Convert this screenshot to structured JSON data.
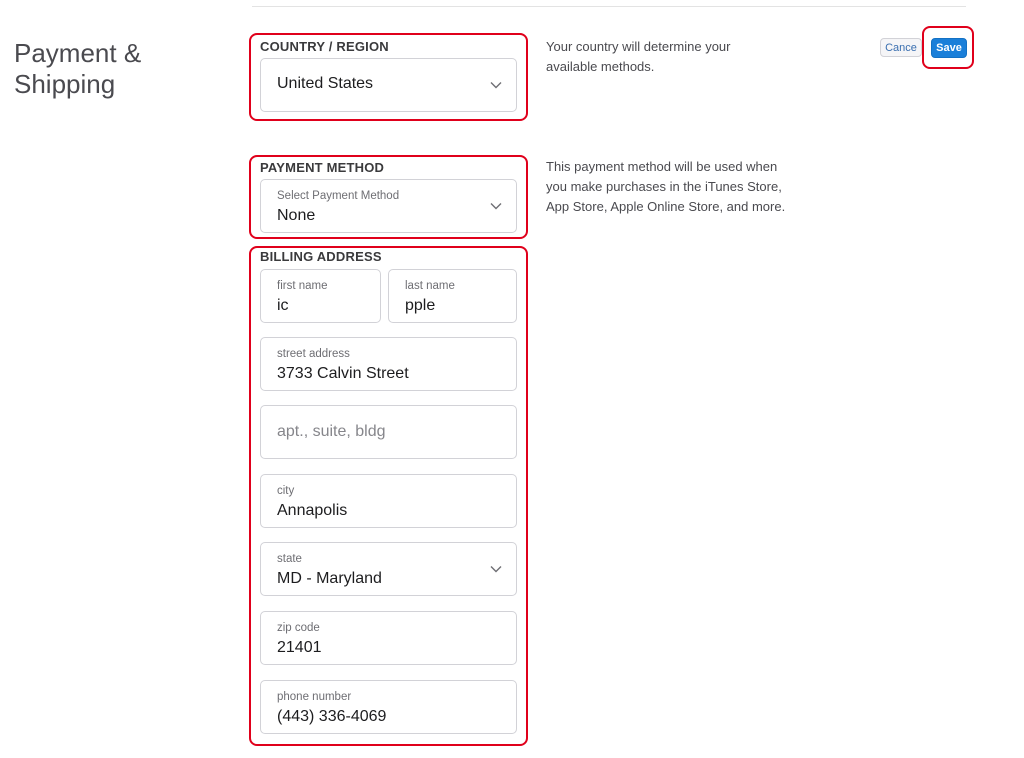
{
  "section": {
    "title_line1": "Payment &",
    "title_line2": "Shipping"
  },
  "toolbar": {
    "cancel_label": "Cance",
    "save_label": "Save"
  },
  "country": {
    "label": "COUNTRY / REGION",
    "value": "United States",
    "help_line1": "Your country will determine your",
    "help_line2": "available methods."
  },
  "payment": {
    "label": "PAYMENT METHOD",
    "select_caption": "Select Payment Method",
    "value": "None",
    "help_line1": "This payment method will be used when",
    "help_line2": "you make purchases in the iTunes Store,",
    "help_line3": "App Store, Apple Online Store, and more."
  },
  "billing": {
    "label": "BILLING ADDRESS",
    "first_name": {
      "caption": "first name",
      "value": "ic"
    },
    "last_name": {
      "caption": "last name",
      "value": "pple"
    },
    "street": {
      "caption": "street address",
      "value": "3733 Calvin Street"
    },
    "apt": {
      "placeholder": "apt., suite, bldg"
    },
    "city": {
      "caption": "city",
      "value": "Annapolis"
    },
    "state": {
      "caption": "state",
      "value": "MD - Maryland"
    },
    "zip": {
      "caption": "zip code",
      "value": "21401"
    },
    "phone": {
      "caption": "phone number",
      "value": "(443) 336-4069"
    }
  },
  "highlight_color": "#e0001b",
  "accent_color": "#1a7fd9",
  "icons": {
    "dropdown": "chevron-down-icon"
  }
}
